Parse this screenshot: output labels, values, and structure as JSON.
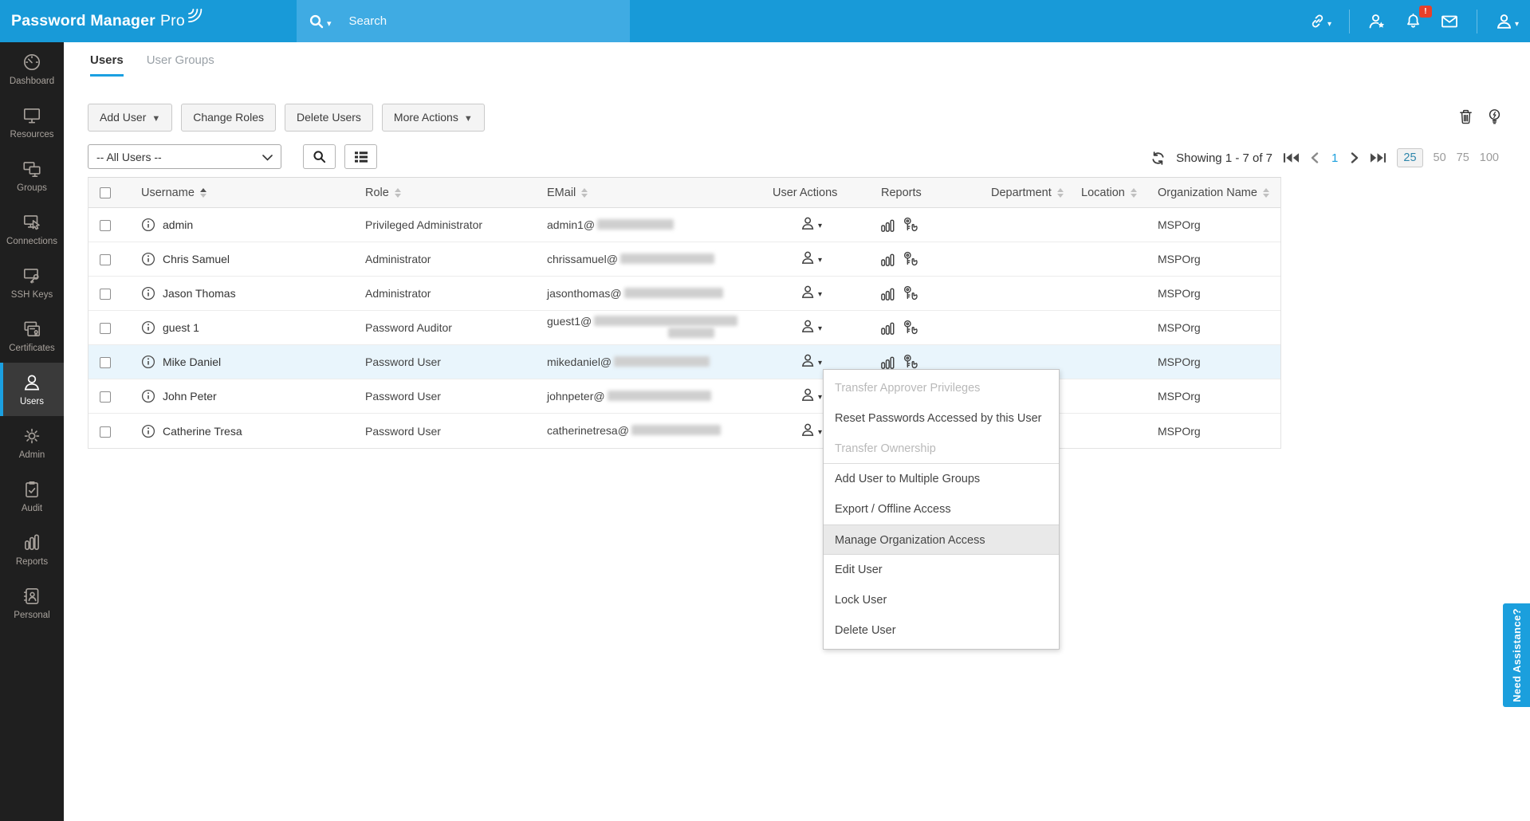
{
  "topbar": {
    "logo": {
      "main": "Password Manager",
      "suffix": "Pro"
    },
    "search": {
      "placeholder": "Search"
    },
    "notifications": {
      "badge": "!"
    }
  },
  "sidebar": {
    "items": [
      {
        "label": "Dashboard"
      },
      {
        "label": "Resources"
      },
      {
        "label": "Groups"
      },
      {
        "label": "Connections"
      },
      {
        "label": "SSH Keys"
      },
      {
        "label": "Certificates"
      },
      {
        "label": "Users",
        "active": true
      },
      {
        "label": "Admin"
      },
      {
        "label": "Audit"
      },
      {
        "label": "Reports"
      },
      {
        "label": "Personal"
      }
    ]
  },
  "tabs": {
    "items": [
      {
        "label": "Users",
        "active": true
      },
      {
        "label": "User Groups"
      }
    ]
  },
  "toolbar": {
    "add_user": "Add User",
    "change_roles": "Change Roles",
    "delete_users": "Delete Users",
    "more_actions": "More Actions"
  },
  "filter": {
    "selected": "-- All Users --"
  },
  "pagination": {
    "showing": "Showing 1 - 7 of 7",
    "current_page": "1",
    "sizes": [
      "25",
      "50",
      "75",
      "100"
    ],
    "selected_size": "25"
  },
  "table": {
    "columns": [
      {
        "label": "Username"
      },
      {
        "label": "Role"
      },
      {
        "label": "EMail"
      },
      {
        "label": "User Actions"
      },
      {
        "label": "Reports"
      },
      {
        "label": "Department"
      },
      {
        "label": "Location"
      },
      {
        "label": "Organization Name"
      }
    ],
    "rows": [
      {
        "username": "admin",
        "role": "Privileged Administrator",
        "email": "admin1@",
        "org": "MSPOrg"
      },
      {
        "username": "Chris Samuel",
        "role": "Administrator",
        "email": "chrissamuel@",
        "org": "MSPOrg"
      },
      {
        "username": "Jason Thomas",
        "role": "Administrator",
        "email": "jasonthomas@",
        "org": "MSPOrg"
      },
      {
        "username": "guest 1",
        "role": "Password Auditor",
        "email": "guest1@",
        "org": "MSPOrg"
      },
      {
        "username": "Mike Daniel",
        "role": "Password User",
        "email": "mikedaniel@",
        "org": "MSPOrg",
        "highlighted": true
      },
      {
        "username": "John Peter",
        "role": "Password User",
        "email": "johnpeter@",
        "org": "MSPOrg"
      },
      {
        "username": "Catherine Tresa",
        "role": "Password User",
        "email": "catherinetresa@",
        "org": "MSPOrg"
      }
    ]
  },
  "context_menu": {
    "items": [
      {
        "label": "Transfer Approver Privileges",
        "disabled": true
      },
      {
        "label": "Reset Passwords Accessed by this User"
      },
      {
        "label": "Transfer Ownership",
        "disabled": true
      },
      {
        "label": "Add User to Multiple Groups"
      },
      {
        "label": "Export / Offline Access"
      },
      {
        "label": "Manage Organization Access",
        "highlighted": true
      },
      {
        "label": "Edit User"
      },
      {
        "label": "Lock User"
      },
      {
        "label": "Delete User"
      }
    ]
  },
  "help_tab": {
    "label": "Need Assistance?"
  },
  "colors": {
    "topbar_blue": "#189ad8",
    "search_blue": "#3fabe3",
    "accent_blue": "#1ba0e1",
    "sidebar_dark": "#1f1f1f",
    "row_highlight": "#e9f5fc",
    "badge_red": "#e8402a"
  }
}
